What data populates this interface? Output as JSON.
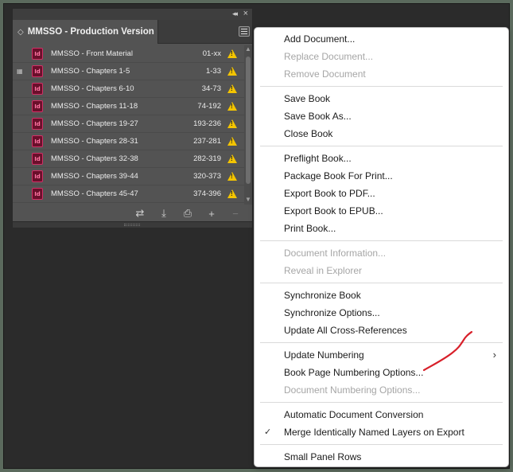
{
  "panel": {
    "title": "MMSSO - Production Version",
    "tab_arrows": "◇",
    "collapse_icon": "◂◂",
    "close_icon": "×",
    "rows": [
      {
        "name": "MMSSO - Front Material",
        "pages": "01-xx",
        "sync": false
      },
      {
        "name": "MMSSO - Chapters 1-5",
        "pages": "1-33",
        "sync": true
      },
      {
        "name": "MMSSO - Chapters 6-10",
        "pages": "34-73",
        "sync": false
      },
      {
        "name": "MMSSO - Chapters 11-18",
        "pages": "74-192",
        "sync": false
      },
      {
        "name": "MMSSO - Chapters 19-27",
        "pages": "193-236",
        "sync": false
      },
      {
        "name": "MMSSO - Chapters 28-31",
        "pages": "237-281",
        "sync": false
      },
      {
        "name": "MMSSO - Chapters 32-38",
        "pages": "282-319",
        "sync": false
      },
      {
        "name": "MMSSO - Chapters 39-44",
        "pages": "320-373",
        "sync": false
      },
      {
        "name": "MMSSO - Chapters 45-47",
        "pages": "374-396",
        "sync": false
      }
    ],
    "doc_icon_text": "Id",
    "toolbar": {
      "sync_glyph": "⇄",
      "save_glyph": "⤓",
      "print_glyph": "⎙",
      "add_glyph": "+",
      "remove_glyph": "−"
    }
  },
  "menu": {
    "groups": [
      [
        {
          "label": "Add Document...",
          "enabled": true
        },
        {
          "label": "Replace Document...",
          "enabled": false
        },
        {
          "label": "Remove Document",
          "enabled": false
        }
      ],
      [
        {
          "label": "Save Book",
          "enabled": true
        },
        {
          "label": "Save Book As...",
          "enabled": true
        },
        {
          "label": "Close Book",
          "enabled": true
        }
      ],
      [
        {
          "label": "Preflight Book...",
          "enabled": true
        },
        {
          "label": "Package Book For Print...",
          "enabled": true
        },
        {
          "label": "Export Book to PDF...",
          "enabled": true
        },
        {
          "label": "Export Book to EPUB...",
          "enabled": true
        },
        {
          "label": "Print Book...",
          "enabled": true
        }
      ],
      [
        {
          "label": "Document Information...",
          "enabled": false
        },
        {
          "label": "Reveal in Explorer",
          "enabled": false
        }
      ],
      [
        {
          "label": "Synchronize Book",
          "enabled": true
        },
        {
          "label": "Synchronize Options...",
          "enabled": true
        },
        {
          "label": "Update All Cross-References",
          "enabled": true
        }
      ],
      [
        {
          "label": "Update Numbering",
          "enabled": true,
          "submenu": true
        },
        {
          "label": "Book Page Numbering Options...",
          "enabled": true
        },
        {
          "label": "Document Numbering Options...",
          "enabled": false
        }
      ],
      [
        {
          "label": "Automatic Document Conversion",
          "enabled": true
        },
        {
          "label": "Merge Identically Named Layers on Export",
          "enabled": true,
          "checked": true
        }
      ],
      [
        {
          "label": "Small Panel Rows",
          "enabled": true
        }
      ]
    ],
    "check_glyph": "✓",
    "submenu_glyph": "›"
  },
  "colors": {
    "annotation_stroke": "#d8202a",
    "warning": "#f3c400",
    "indesign_icon": "#6a0f2b"
  }
}
